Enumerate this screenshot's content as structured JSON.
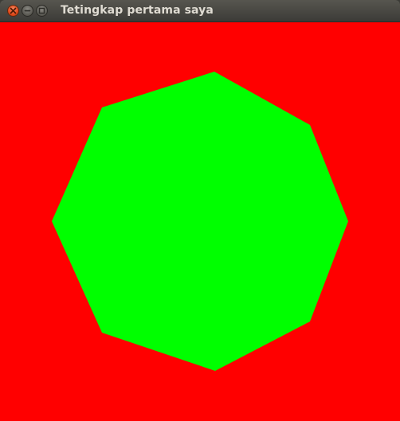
{
  "window": {
    "title": "Tetingkap pertama saya",
    "controls": {
      "close_icon": "close-icon",
      "minimize_icon": "minimize-icon",
      "maximize_icon": "maximize-icon"
    }
  },
  "canvas": {
    "background_color": "#ff0000",
    "shape": {
      "type": "octagon",
      "fill_color": "#00ff00"
    }
  }
}
